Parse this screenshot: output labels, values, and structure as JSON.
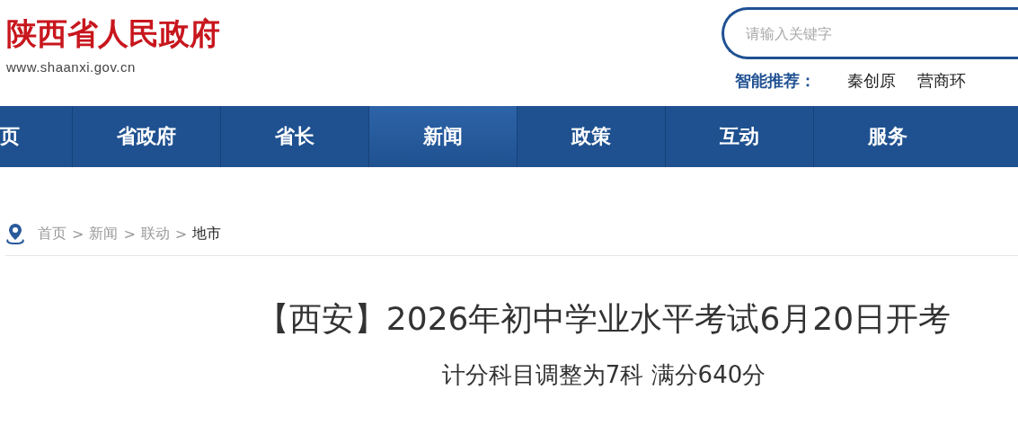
{
  "site": {
    "title": "陕西省人民政府",
    "url": "www.shaanxi.gov.cn"
  },
  "search": {
    "placeholder": "请输入关键字"
  },
  "recommend": {
    "label": "智能推荐：",
    "items": [
      "秦创原",
      "营商环"
    ]
  },
  "nav": [
    {
      "label": "页",
      "selected": false
    },
    {
      "label": "省政府",
      "selected": false
    },
    {
      "label": "省长",
      "selected": false
    },
    {
      "label": "新闻",
      "selected": true
    },
    {
      "label": "政策",
      "selected": false
    },
    {
      "label": "互动",
      "selected": false
    },
    {
      "label": "服务",
      "selected": false
    }
  ],
  "breadcrumb": [
    {
      "kind": "link",
      "label": "首页",
      "current": false
    },
    {
      "kind": "separator",
      "label": ">"
    },
    {
      "kind": "link",
      "label": "新闻",
      "current": false
    },
    {
      "kind": "separator",
      "label": ">"
    },
    {
      "kind": "link",
      "label": "联动",
      "current": false
    },
    {
      "kind": "separator",
      "label": ">"
    },
    {
      "kind": "link",
      "label": "地市",
      "current": true
    }
  ],
  "article": {
    "title": "【西安】2026年初中学业水平考试6月20日开考",
    "subtitle": "计分科目调整为7科 满分640分"
  }
}
